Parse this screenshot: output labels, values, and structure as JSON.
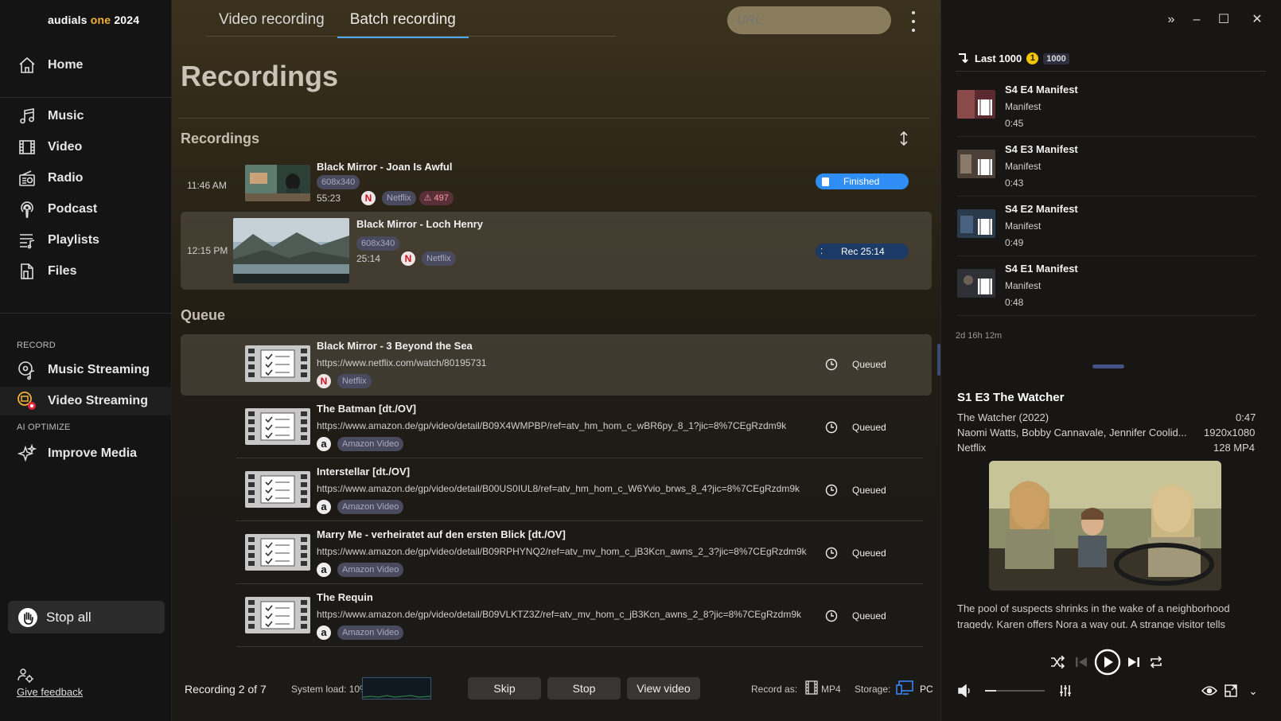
{
  "app": {
    "brand_main": "audials ",
    "brand_one": "one",
    "brand_year": " 2024"
  },
  "sidebar": {
    "items": [
      {
        "label": "Home"
      },
      {
        "label": "Music"
      },
      {
        "label": "Video"
      },
      {
        "label": "Radio"
      },
      {
        "label": "Podcast"
      },
      {
        "label": "Playlists"
      },
      {
        "label": "Files"
      }
    ],
    "record_section": "RECORD",
    "record_items": [
      {
        "label": "Music Streaming"
      },
      {
        "label": "Video Streaming"
      }
    ],
    "optimize_section": "AI OPTIMIZE",
    "optimize_items": [
      {
        "label": "Improve Media"
      }
    ],
    "stop_all": "Stop all",
    "feedback": "Give feedback"
  },
  "tabs": [
    {
      "label": "Video recording"
    },
    {
      "label": "Batch recording"
    }
  ],
  "url_placeholder": "URL",
  "main": {
    "heading": "Recordings",
    "recordings_label": "Recordings",
    "queue_label": "Queue",
    "recordings": [
      {
        "time": "11:46 AM",
        "title": "Black Mirror - Joan Is Awful",
        "resolution": "608x340",
        "duration": "55:23",
        "service_icon": "N",
        "service": "Netflix",
        "warning": "497",
        "status": "Finished"
      },
      {
        "time": "12:15 PM",
        "title": "Black Mirror - Loch Henry",
        "resolution": "608x340",
        "duration": "25:14",
        "service_icon": "N",
        "service": "Netflix",
        "status": "Rec 25:14"
      }
    ],
    "queue": [
      {
        "title": "Black Mirror - 3 Beyond the Sea",
        "url": "https://www.netflix.com/watch/80195731",
        "service_icon": "N",
        "service": "Netflix",
        "status": "Queued"
      },
      {
        "title": "The Batman [dt./OV]",
        "url": "https://www.amazon.de/gp/video/detail/B09X4WMPBP/ref=atv_hm_hom_c_wBR6py_8_1?jic=8%7CEgRzdm9k",
        "service_icon": "a",
        "service": "Amazon Video",
        "status": "Queued"
      },
      {
        "title": "Interstellar [dt./OV]",
        "url": "https://www.amazon.de/gp/video/detail/B00US0IUL8/ref=atv_hm_hom_c_W6Yvio_brws_8_4?jic=8%7CEgRzdm9k",
        "service_icon": "a",
        "service": "Amazon Video",
        "status": "Queued"
      },
      {
        "title": "Marry Me - verheiratet auf den ersten Blick [dt./OV]",
        "url": "https://www.amazon.de/gp/video/detail/B09RPHYNQ2/ref=atv_mv_hom_c_jB3Kcn_awns_2_3?jic=8%7CEgRzdm9k",
        "service_icon": "a",
        "service": "Amazon Video",
        "status": "Queued"
      },
      {
        "title": "The Requin",
        "url": "https://www.amazon.de/gp/video/detail/B09VLKTZ3Z/ref=atv_mv_hom_c_jB3Kcn_awns_2_8?jic=8%7CEgRzdm9k",
        "service_icon": "a",
        "service": "Amazon Video",
        "status": "Queued"
      }
    ]
  },
  "footer": {
    "recording_status": "Recording 2 of 7",
    "system_load": "System load: 10%",
    "skip": "Skip",
    "stop": "Stop",
    "view_video": "View video",
    "record_as_label": "Record as:",
    "format": "MP4",
    "storage_label": "Storage:",
    "storage": "PC"
  },
  "right": {
    "last_label": "Last 1000",
    "last_badge": "1",
    "last_count": "1000",
    "episodes": [
      {
        "title": "S4 E4 Manifest",
        "show": "Manifest",
        "duration": "0:45"
      },
      {
        "title": "S4 E3 Manifest",
        "show": "Manifest",
        "duration": "0:43"
      },
      {
        "title": "S4 E2 Manifest",
        "show": "Manifest",
        "duration": "0:49"
      },
      {
        "title": "S4 E1 Manifest",
        "show": "Manifest",
        "duration": "0:48"
      }
    ],
    "total_duration": "2d 16h 12m",
    "now": {
      "title": "S1 E3 The Watcher",
      "show": "The Watcher (2022)",
      "duration": "0:47",
      "cast": "Naomi Watts, Bobby Cannavale, Jennifer Coolid...",
      "resolution": "1920x1080",
      "service": "Netflix",
      "size": "128 MP4",
      "description": "The pool of suspects shrinks in the wake of a neighborhood tragedy. Karen offers Nora a way out. A strange visitor tells"
    }
  },
  "colors": {
    "accent": "#4aa8ff",
    "brand_one": "#f3b23a",
    "finished": "#2f8ef5",
    "recording": "#1c3a66",
    "netflix": "#d01020"
  }
}
